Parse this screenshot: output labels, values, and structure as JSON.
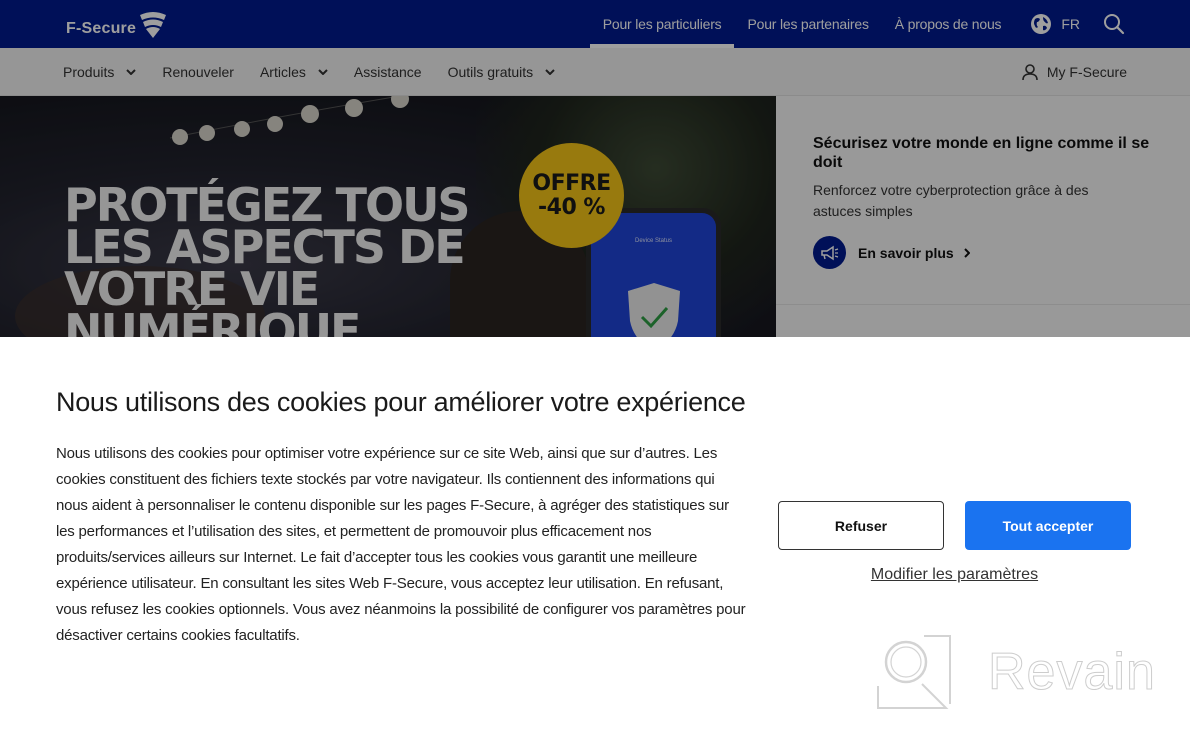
{
  "header": {
    "brand": "F-Secure",
    "top_nav": [
      {
        "label": "Pour les particuliers",
        "active": true
      },
      {
        "label": "Pour les partenaires",
        "active": false
      },
      {
        "label": "À propos de nous",
        "active": false
      }
    ],
    "language": "FR",
    "brand_color": "#001a8f"
  },
  "subnav": {
    "items": [
      {
        "label": "Produits",
        "has_dropdown": true
      },
      {
        "label": "Renouveler",
        "has_dropdown": false
      },
      {
        "label": "Articles",
        "has_dropdown": true
      },
      {
        "label": "Assistance",
        "has_dropdown": false
      },
      {
        "label": "Outils gratuits",
        "has_dropdown": true
      }
    ],
    "account_label": "My F-Secure"
  },
  "hero": {
    "title_lines": [
      "PROTÉGEZ TOUS",
      "LES ASPECTS DE",
      "VOTRE VIE",
      "NUMÉRIQUE"
    ],
    "offer_line1": "OFFRE",
    "offer_line2": "-40 %",
    "phone_label": "Device Status",
    "offer_color": "#f5c518"
  },
  "promo": {
    "title": "Sécurisez votre monde en ligne comme il se doit",
    "text": "Renforcez votre cyberprotection grâce à des astuces simples",
    "link_label": "En savoir plus"
  },
  "cookie_banner": {
    "title": "Nous utilisons des cookies pour améliorer votre expérience",
    "body": "Nous utilisons des cookies pour optimiser votre expérience sur ce site Web, ainsi que sur d’autres. Les cookies constituent des fichiers texte stockés par votre navigateur. Ils contiennent des informations qui nous aident à personnaliser le contenu disponible sur les pages F-Secure, à agréger des statistiques sur les performances et l’utilisation des sites, et permettent de promouvoir plus efficacement nos produits/services ailleurs sur Internet. Le fait d’accepter tous les cookies vous garantit une meilleure expérience utilisateur. En consultant les sites Web F-Secure, vous acceptez leur utilisation. En refusant, vous refusez les cookies optionnels. Vous avez néanmoins la possibilité de configurer vos paramètres pour désactiver certains cookies facultatifs.",
    "refuse_label": "Refuser",
    "accept_label": "Tout accepter",
    "settings_label": "Modifier les paramètres",
    "accept_color": "#1a73f0"
  },
  "watermark": {
    "text": "Revain"
  }
}
